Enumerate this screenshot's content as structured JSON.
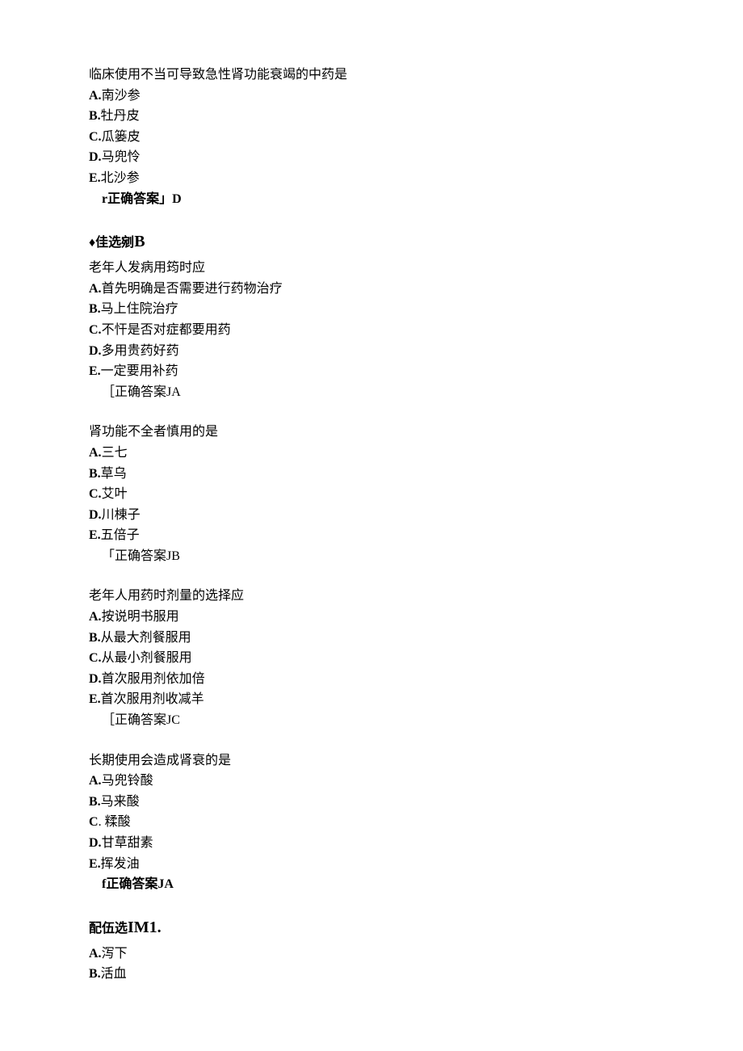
{
  "questions": [
    {
      "text": "临床使用不当可导致急性肾功能衰竭的中药是",
      "options": [
        {
          "label": "A.",
          "text": "南沙参"
        },
        {
          "label": "B.",
          "text": "牡丹皮"
        },
        {
          "label": "C.",
          "text": "瓜篓皮"
        },
        {
          "label": "D.",
          "text": "马兜怜"
        },
        {
          "label": "E.",
          "text": "北沙参"
        }
      ],
      "answer_prefix": "r正确答案」",
      "answer_value": "D"
    }
  ],
  "section_b": {
    "bullet": "♦",
    "label_part1": "佳选剜",
    "label_part2": "B",
    "questions": [
      {
        "text": "老年人发病用筠时应",
        "options": [
          {
            "label": "A.",
            "text": "首先明确是否需要进行药物治疗"
          },
          {
            "label": "B.",
            "text": "马上住院治疗"
          },
          {
            "label": "C.",
            "text": "不忓是否对症都要用药"
          },
          {
            "label": "D.",
            "text": "多用贵药好药"
          },
          {
            "label": "E.",
            "text": "一定要用补药"
          }
        ],
        "answer_prefix": "［正确答案J",
        "answer_value": "A"
      },
      {
        "text": "肾功能不全者慎用的是",
        "options": [
          {
            "label": "A.",
            "text": "三七"
          },
          {
            "label": "B.",
            "text": "草乌"
          },
          {
            "label": "C.",
            "text": "艾叶"
          },
          {
            "label": "D.",
            "text": "川棟子"
          },
          {
            "label": "E.",
            "text": "五倍子"
          }
        ],
        "answer_prefix": "「正确答案J",
        "answer_value": "B"
      },
      {
        "text": "老年人用药时剂量的选择应",
        "options": [
          {
            "label": "A.",
            "text": "按说明书服用"
          },
          {
            "label": "B.",
            "text": "从最大剂餐服用"
          },
          {
            "label": "C.",
            "text": "从最小剂餐服用"
          },
          {
            "label": "D.",
            "text": "首次服用剂依加倍"
          },
          {
            "label": "E.",
            "text": "首次服用剂收减羊"
          }
        ],
        "answer_prefix": "［正确答案J",
        "answer_value": "C"
      },
      {
        "text": "长期使用会造成肾衰的是",
        "options": [
          {
            "label": "A.",
            "text": "马兜铃酸"
          },
          {
            "label": "B.",
            "text": "马来酸"
          },
          {
            "label": "C",
            "text": ". 糅酸"
          },
          {
            "label": "D.",
            "text": "甘草甜素"
          },
          {
            "label": "E.",
            "text": "挥发油"
          }
        ],
        "answer_prefix": "f正确答案J",
        "answer_value": "A"
      }
    ]
  },
  "section_match": {
    "label_part1": "配伍选",
    "label_part2": "IM1.",
    "options": [
      {
        "label": "A.",
        "text": "泻下"
      },
      {
        "label": "B.",
        "text": "活血"
      }
    ]
  }
}
